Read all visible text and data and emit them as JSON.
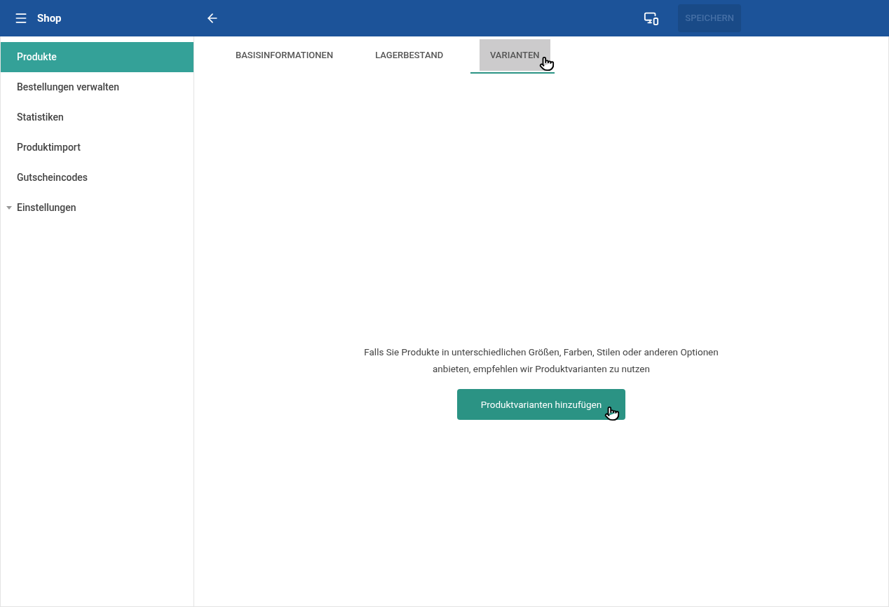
{
  "app_bar": {
    "title": "Shop",
    "save_button": {
      "label": "SPEICHERN",
      "disabled": true
    }
  },
  "sidebar": {
    "items": [
      {
        "label": "Produkte",
        "selected": true,
        "kind": "link"
      },
      {
        "label": "Bestellungen verwalten",
        "selected": false,
        "kind": "link"
      },
      {
        "label": "Statistiken",
        "selected": false,
        "kind": "link"
      },
      {
        "label": "Produktimport",
        "selected": false,
        "kind": "link"
      },
      {
        "label": "Gutscheincodes",
        "selected": false,
        "kind": "link"
      },
      {
        "label": "Einstellungen",
        "selected": false,
        "kind": "group",
        "expanded": false
      }
    ]
  },
  "tabs": [
    {
      "label": "BASISINFORMATIONEN",
      "selected": false
    },
    {
      "label": "LAGERBESTAND",
      "selected": false
    },
    {
      "label": "VARIANTEN",
      "selected": true
    }
  ],
  "empty_state": {
    "message": "Falls Sie Produkte in unterschiedlichen Größen, Farben, Stilen oder anderen Optionen anbieten, empfehlen wir Produktvarianten zu nutzen",
    "button": "Produktvarianten hinzufügen"
  }
}
